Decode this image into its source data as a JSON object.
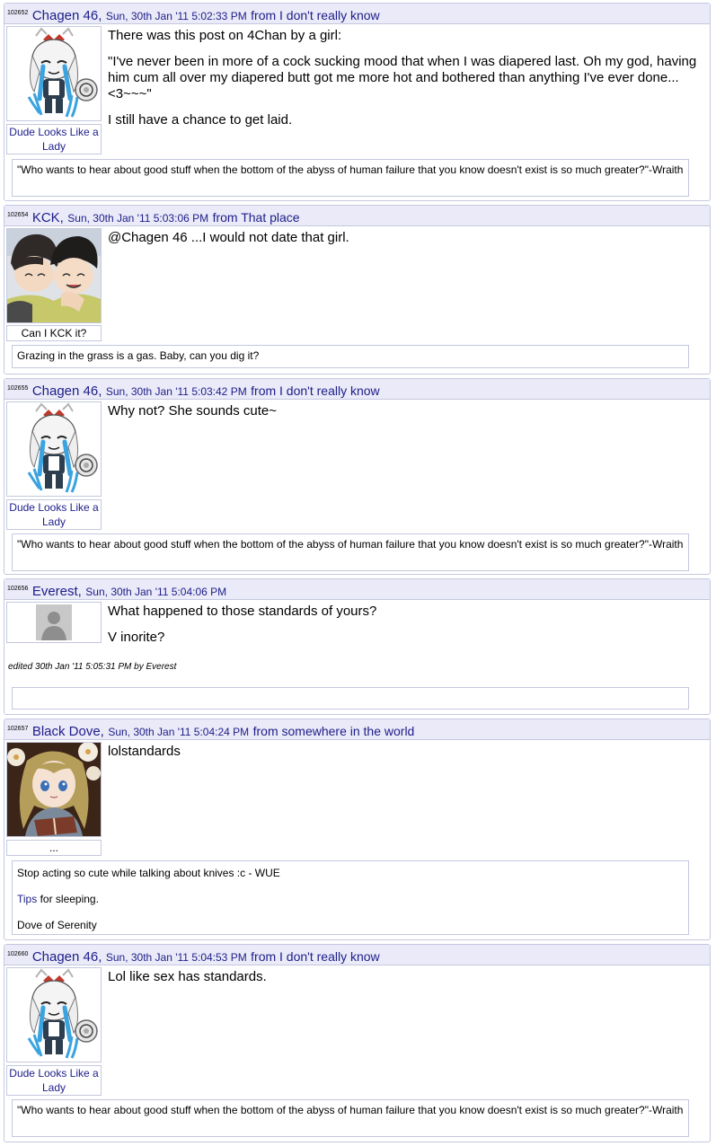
{
  "posts": [
    {
      "id": "102652",
      "author": "Chagen 46,",
      "date": "Sun, 30th Jan '11 5:02:33 PM",
      "from": "from I don't really know",
      "avatar": "chibi-avatar",
      "avatar_caption": "Dude Looks Like a Lady",
      "message": [
        "There was this post on 4Chan by a girl:",
        "\"I've never been in more of a cock sucking mood that when I was diapered last. Oh my god, having him cum all over my diapered butt got me more hot and bothered than anything I've ever done...<3~~~\"",
        "I still have a chance to get laid."
      ],
      "signature": [
        "\"Who wants to hear about good stuff when the bottom of the abyss of human failure that you know doesn't exist is so much greater?\"-Wraith"
      ]
    },
    {
      "id": "102654",
      "author": "KCK,",
      "date": "Sun, 30th Jan '11 5:03:06 PM",
      "from": "from That place",
      "avatar": "anime-pair-avatar",
      "avatar_caption": "Can I KCK it?",
      "message": [
        "@Chagen 46 ...I would not date that girl."
      ],
      "signature": [
        "Grazing in the grass is a gas. Baby, can you dig it?"
      ]
    },
    {
      "id": "102655",
      "author": "Chagen 46,",
      "date": "Sun, 30th Jan '11 5:03:42 PM",
      "from": "from I don't really know",
      "avatar": "chibi-avatar",
      "avatar_caption": "Dude Looks Like a Lady",
      "message": [
        "Why not? She sounds cute~"
      ],
      "signature": [
        "\"Who wants to hear about good stuff when the bottom of the abyss of human failure that you know doesn't exist is so much greater?\"-Wraith"
      ]
    },
    {
      "id": "102656",
      "author": "Everest,",
      "date": "Sun, 30th Jan '11 5:04:06 PM",
      "from": "",
      "avatar": "default-user-avatar",
      "message": [
        "What happened to those standards of yours?",
        "V inorite?"
      ],
      "edited": "edited 30th Jan '11 5:05:31 PM by Everest",
      "signature": []
    },
    {
      "id": "102657",
      "author": "Black Dove,",
      "date": "Sun, 30th Jan '11 5:04:24 PM",
      "from": "from somewhere in the world",
      "avatar": "anime-girl-book-avatar",
      "avatar_caption": "...",
      "message": [
        "lolstandards"
      ],
      "signature": [
        "Stop acting so cute while talking about knives :c - WUE",
        "Tips for sleeping.",
        "Dove of Serenity"
      ],
      "signature_link": "Tips",
      "signature_link_suffix": " for sleeping."
    },
    {
      "id": "102660",
      "author": "Chagen 46,",
      "date": "Sun, 30th Jan '11 5:04:53 PM",
      "from": "from I don't really know",
      "avatar": "chibi-avatar",
      "avatar_caption": "Dude Looks Like a Lady",
      "message": [
        "Lol like sex has standards."
      ],
      "signature": [
        "\"Who wants to hear about good stuff when the bottom of the abyss of human failure that you know doesn't exist is so much greater?\"-Wraith"
      ]
    }
  ],
  "colors": {
    "header_bg": "#eaeaf8",
    "border": "#c4c8de",
    "link": "#1d1d8a"
  }
}
